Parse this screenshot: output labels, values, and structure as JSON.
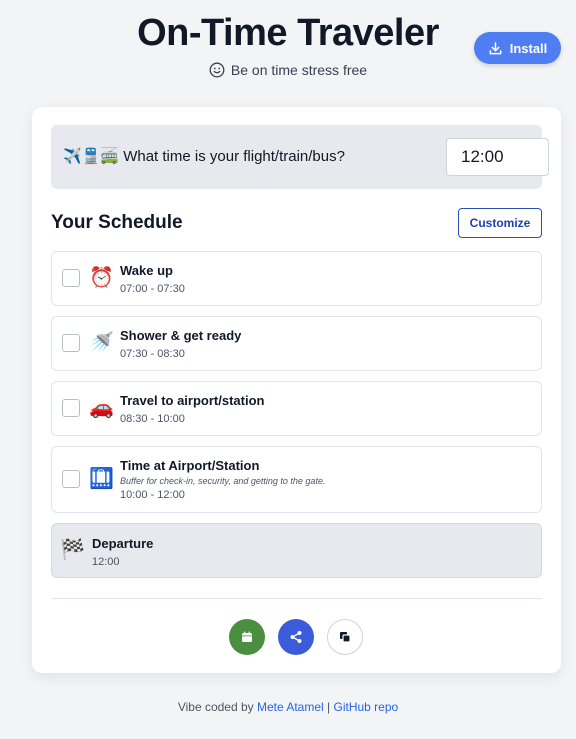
{
  "header": {
    "title": "On-Time Traveler",
    "subtitle": "Be on time stress free",
    "install_label": "Install"
  },
  "question": {
    "emojis": "✈️🚆🚎",
    "label": "What time is your flight/train/bus?",
    "time_value": "12:00"
  },
  "schedule": {
    "title": "Your Schedule",
    "customize_label": "Customize",
    "items": [
      {
        "emoji": "⏰",
        "title": "Wake up",
        "time": "07:00 - 07:30"
      },
      {
        "emoji": "🚿",
        "title": "Shower & get ready",
        "time": "07:30 - 08:30"
      },
      {
        "emoji": "🚗",
        "title": "Travel to airport/station",
        "time": "08:30 - 10:00"
      },
      {
        "emoji": "🛄",
        "title": "Time at Airport/Station",
        "note": "Buffer for check-in, security, and getting to the gate.",
        "time": "10:00 - 12:00"
      }
    ],
    "departure": {
      "emoji": "🏁",
      "title": "Departure",
      "time": "12:00"
    }
  },
  "actions": {
    "calendar_color": "#4a8f3f",
    "share_color": "#3b5bdb",
    "copy_color": "#ffffff"
  },
  "footer": {
    "prefix": "Vibe coded by ",
    "author": "Mete Atamel",
    "separator": " | ",
    "repo": "GitHub repo"
  }
}
